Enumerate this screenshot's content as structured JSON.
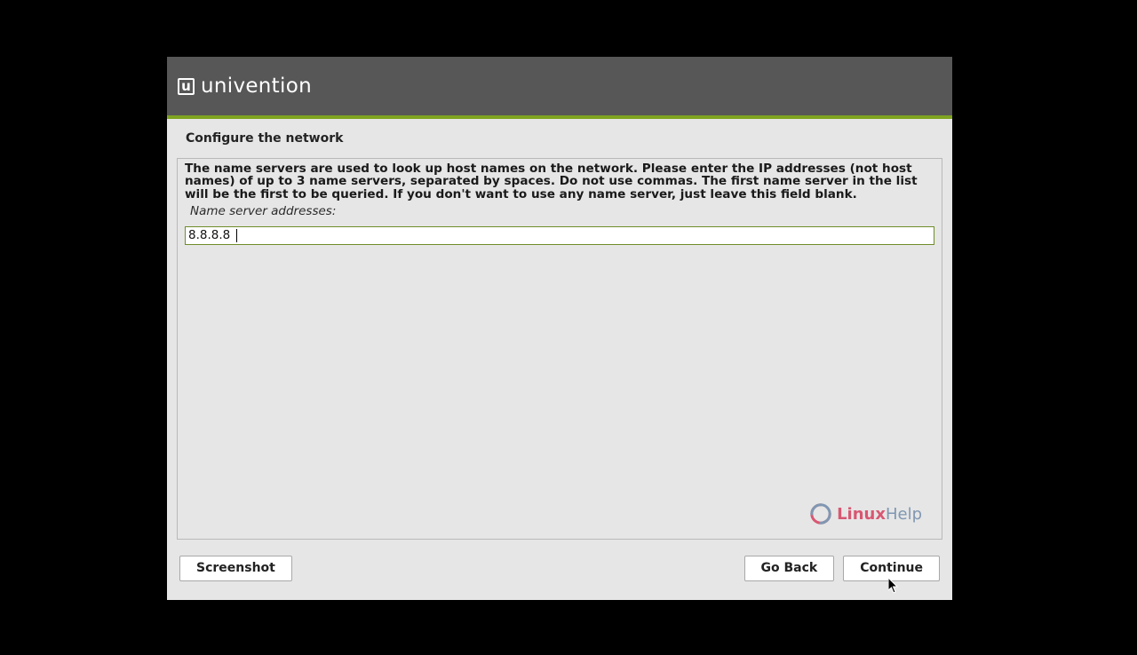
{
  "brand": "univention",
  "page_title": "Configure the network",
  "description": "The name servers are used to look up host names on the network. Please enter the IP addresses (not host names) of up to 3 name servers, separated by spaces. Do not use commas. The first name server in the list will be the first to be queried. If you don't want to use any name server, just leave this field blank.",
  "field_label": "Name server addresses:",
  "input_value": "8.8.8.8",
  "buttons": {
    "screenshot": "Screenshot",
    "go_back": "Go Back",
    "continue": "Continue"
  },
  "watermark": {
    "a": "Linux",
    "b": "Help"
  }
}
